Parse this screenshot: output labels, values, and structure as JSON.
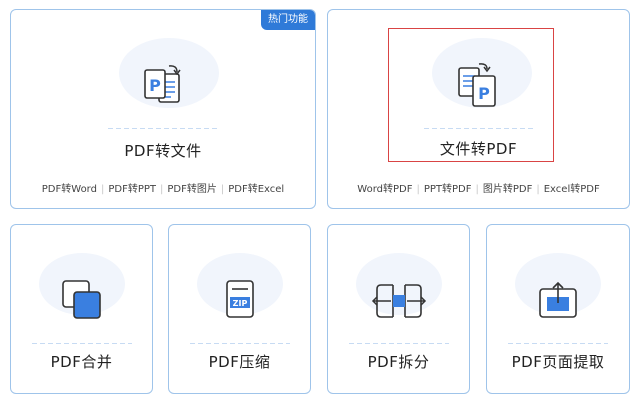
{
  "badge": {
    "label": "热门功能"
  },
  "pdf_to_file": {
    "title": "PDF转文件",
    "links": [
      "PDF转Word",
      "PDF转PPT",
      "PDF转图片",
      "PDF转Excel"
    ]
  },
  "file_to_pdf": {
    "title": "文件转PDF",
    "links": [
      "Word转PDF",
      "PPT转PDF",
      "图片转PDF",
      "Excel转PDF"
    ]
  },
  "tools": {
    "merge": {
      "title": "PDF合并",
      "icon": "merge-icon"
    },
    "compress": {
      "title": "PDF压缩",
      "icon": "zip-file-icon",
      "zip_label": "ZIP"
    },
    "split": {
      "title": "PDF拆分",
      "icon": "split-icon"
    },
    "extract": {
      "title": "PDF页面提取",
      "icon": "extract-page-icon"
    }
  },
  "doc_letter": "P",
  "colors": {
    "accent": "#2f7ad8",
    "icon_fill": "#3a7fe0",
    "card_border": "#9fc4ea",
    "highlight": "#d94444"
  }
}
